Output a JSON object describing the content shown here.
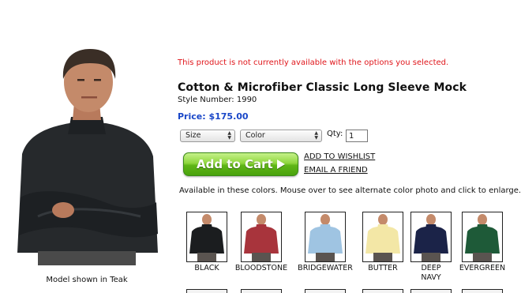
{
  "product": {
    "availability_notice": "This product is not currently available with the options you selected.",
    "title": "Cotton & Microfiber Classic Long Sleeve Mock",
    "style_number": "Style Number: 1990",
    "price": "Price: $175.00"
  },
  "options": {
    "size_label": "Size",
    "color_label": "Color",
    "qty_label": "Qty:",
    "qty_value": "1"
  },
  "actions": {
    "add_to_cart": "Add to Cart",
    "add_to_wishlist": "ADD TO WISHLIST",
    "email_friend": "EMAIL A FRIEND"
  },
  "availability_text": "Available in these colors. Mouse over to see alternate color photo and click to enlarge.",
  "model_caption": "Model shown in Teak",
  "colors": {
    "notice_red": "#e0161b",
    "price_blue": "#1a47c8",
    "cart_green": "#5fb517"
  },
  "swatches": [
    {
      "name": "BLACK",
      "color": "#1b1d1f"
    },
    {
      "name": "BLOODSTONE",
      "color": "#a8343c"
    },
    {
      "name": "BRIDGEWATER",
      "color": "#9fc4e2"
    },
    {
      "name": "BUTTER",
      "color": "#f3e7a6"
    },
    {
      "name": "DEEP NAVY",
      "color": "#1b2348"
    },
    {
      "name": "EVERGREEN",
      "color": "#1e5a38"
    }
  ]
}
